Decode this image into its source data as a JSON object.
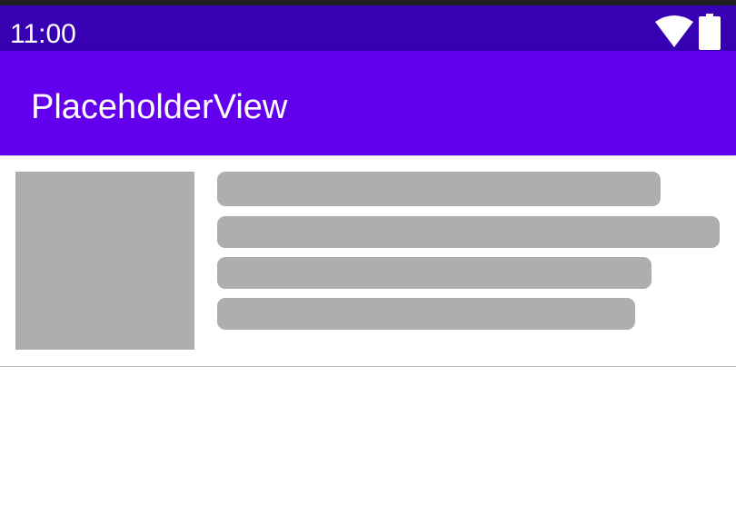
{
  "status_bar": {
    "time": "11:00",
    "background_color": "#3700b3",
    "icons": [
      "wifi-icon",
      "battery-icon"
    ]
  },
  "app_bar": {
    "title": "PlaceholderView",
    "background_color": "#6200ee"
  },
  "placeholder_item": {
    "image_color": "#aeaeae",
    "line_count": 4
  }
}
